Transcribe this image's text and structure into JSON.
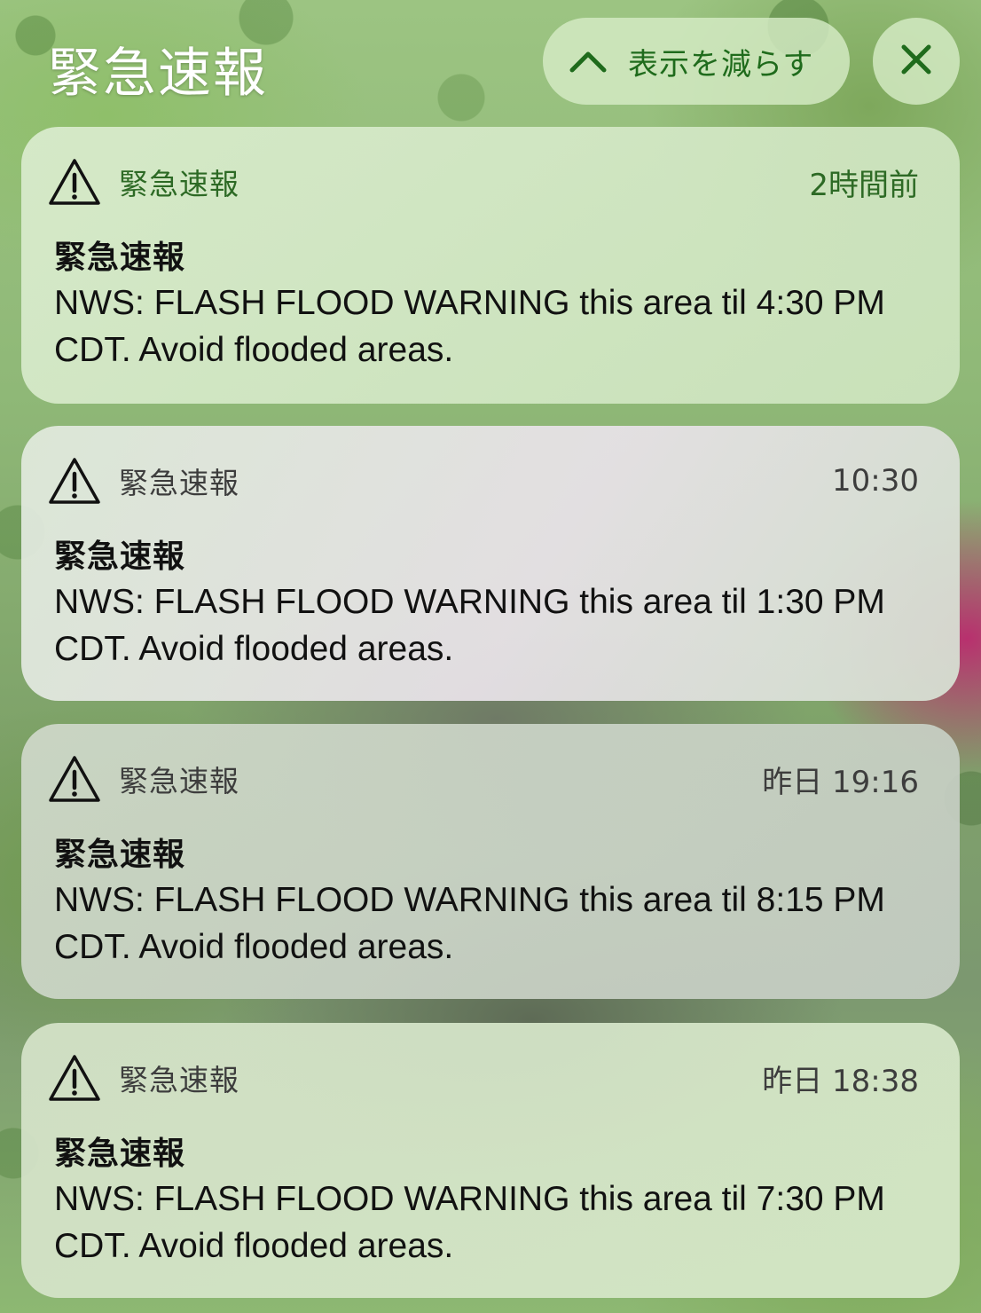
{
  "header": {
    "title": "緊急速報",
    "show_less_label": "表示を減らす"
  },
  "colors": {
    "accent": "#1f6b1c",
    "button_bg": "#d6ecc6"
  },
  "icons": {
    "show_less": "chevron-up-icon",
    "close": "close-icon",
    "alert": "warning-triangle-icon"
  },
  "notifications": [
    {
      "app": "緊急速報",
      "time": "2時間前",
      "title": "緊急速報",
      "body": "NWS: FLASH FLOOD WARNING this area til 4:30 PM CDT. Avoid flooded areas."
    },
    {
      "app": "緊急速報",
      "time": "10:30",
      "title": "緊急速報",
      "body": "NWS: FLASH FLOOD WARNING this area til 1:30 PM CDT. Avoid flooded areas."
    },
    {
      "app": "緊急速報",
      "time": "昨日 19:16",
      "title": "緊急速報",
      "body": "NWS: FLASH FLOOD WARNING this area til 8:15 PM CDT. Avoid flooded areas."
    },
    {
      "app": "緊急速報",
      "time": "昨日 18:38",
      "title": "緊急速報",
      "body": "NWS: FLASH FLOOD WARNING this area til 7:30 PM CDT. Avoid flooded areas."
    }
  ]
}
